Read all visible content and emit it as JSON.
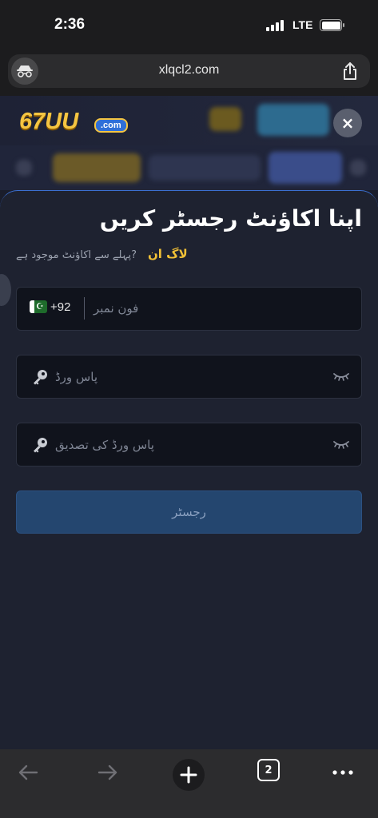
{
  "status_bar": {
    "time": "2:36",
    "network": "LTE"
  },
  "browser": {
    "url": "xlqcl2.com",
    "open_tabs_count": "2",
    "icons": {
      "incognito": "incognito-icon",
      "share": "share-icon",
      "back": "back-arrow-icon",
      "forward": "forward-arrow-icon",
      "new_tab": "plus-icon",
      "tabs": "tabs-icon",
      "more": "more-dots-icon"
    }
  },
  "site": {
    "logo_number": "67UU",
    "logo_suffix": ".com",
    "close_symbol": "×",
    "accent": "#3b6fd0",
    "brand_gold": "#f2c136"
  },
  "register_form": {
    "title": "اپنا اکاؤنٹ رجسٹر کریں",
    "have_account_text": "?پہلے سے اکاؤنٹ موجود ہے",
    "login_link": "لاگ ان",
    "phone": {
      "country_code": "+92",
      "flag": "pakistan-flag",
      "placeholder": "فون نمبر"
    },
    "password": {
      "placeholder": "پاس ورڈ"
    },
    "confirm_password": {
      "placeholder": "پاس ورڈ کی تصدیق"
    },
    "submit_label": "رجسٹر"
  }
}
